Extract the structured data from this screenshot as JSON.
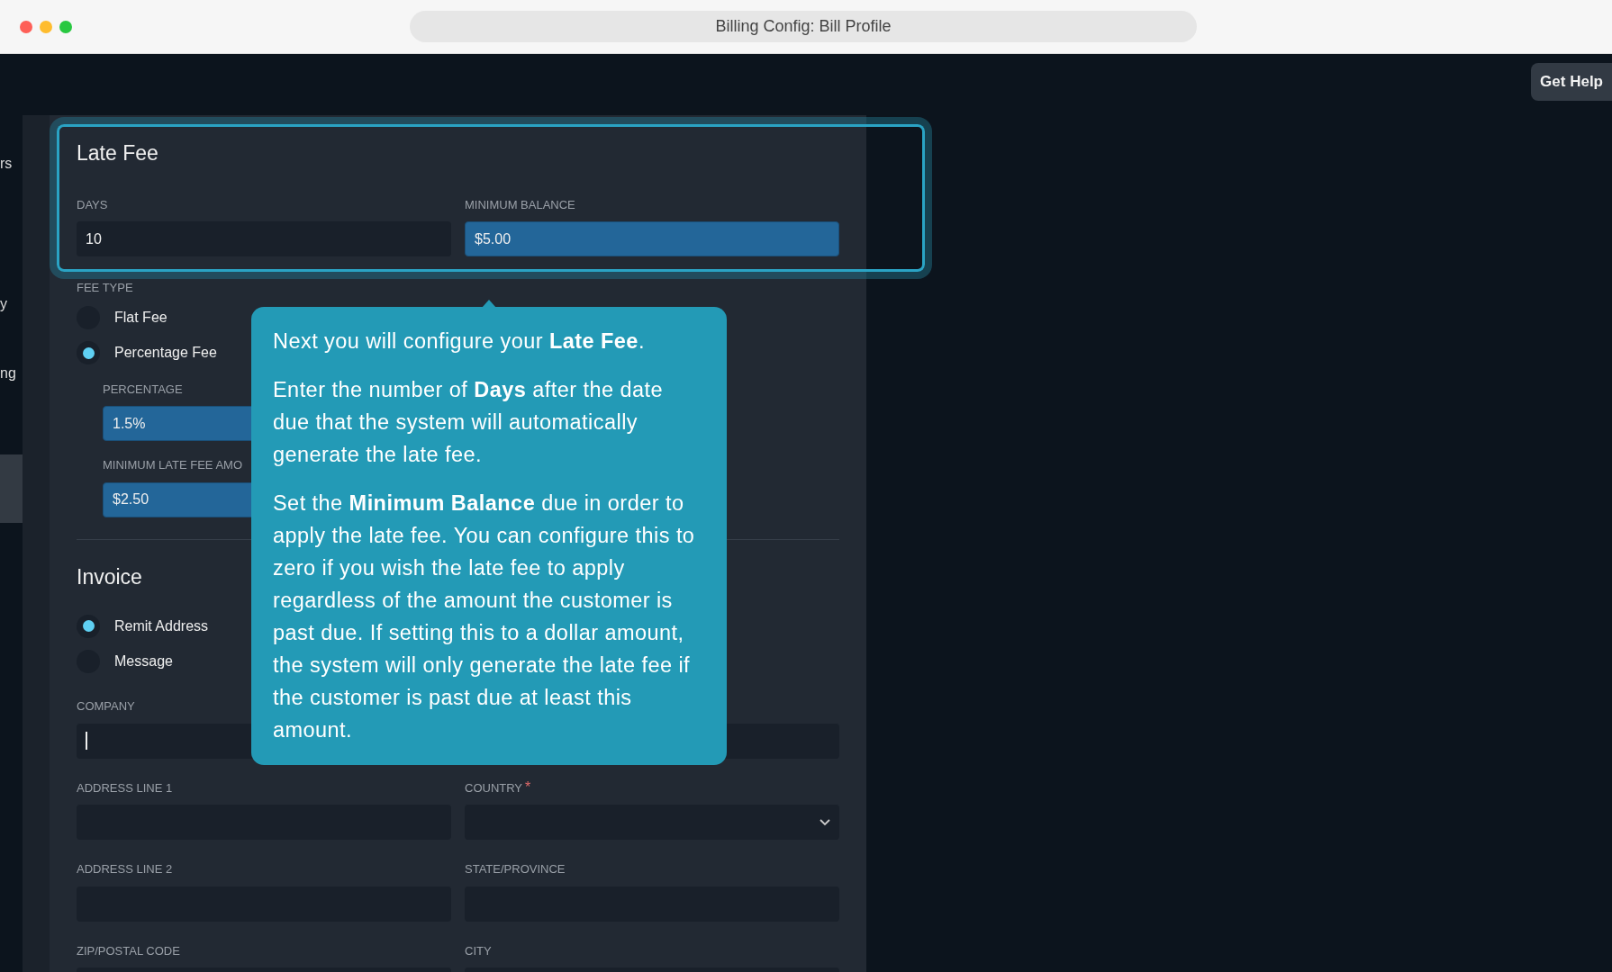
{
  "window": {
    "title": "Billing Config: Bill Profile"
  },
  "header": {
    "help_button": "Get Help"
  },
  "sidebar": {
    "items": [
      {
        "label": "rs",
        "selected": false
      },
      {
        "label": "y",
        "selected": false
      },
      {
        "label": "ng",
        "selected": false
      },
      {
        "selected": true
      }
    ]
  },
  "late_fee": {
    "title": "Late Fee",
    "fields": [
      {
        "label": "DAYS",
        "value": "10",
        "highlighted": false
      },
      {
        "label": "MINIMUM BALANCE",
        "value": "$5.00",
        "highlighted": true
      }
    ],
    "fee_type": {
      "label": "FEE TYPE",
      "options": [
        {
          "label": "Flat Fee",
          "selected": false
        },
        {
          "label": "Percentage Fee",
          "selected": true
        }
      ]
    },
    "percentage_fields": [
      {
        "label": "PERCENTAGE",
        "value": "1.5%",
        "highlighted": true
      },
      {
        "label": "MINIMUM LATE FEE AMO",
        "value": "$2.50",
        "highlighted": true
      }
    ]
  },
  "invoice": {
    "title": "Invoice",
    "options": [
      {
        "label": "Remit Address",
        "selected": true
      },
      {
        "label": "Message",
        "selected": false
      }
    ],
    "rows": [
      [
        {
          "label": "COMPANY",
          "kind": "text",
          "focused": true
        }
      ],
      [
        {
          "label": "ADDRESS LINE 1",
          "kind": "text",
          "focused": false
        },
        {
          "label": "COUNTRY",
          "kind": "select",
          "required_mark": "*"
        }
      ],
      [
        {
          "label": "ADDRESS LINE 2",
          "kind": "text",
          "focused": false
        },
        {
          "label": "STATE/PROVINCE",
          "kind": "text",
          "focused": false
        }
      ],
      [
        {
          "label": "ZIP/POSTAL CODE",
          "kind": "text"
        },
        {
          "label": "CITY",
          "kind": "text"
        }
      ]
    ]
  },
  "tour_tip": {
    "paragraphs": [
      "Next you will configure your **Late Fee**.",
      "Enter the number of **Days** after the date due that the system will automatically generate the late fee.",
      "Set the **Minimum Balance** due in order to apply the late fee. You can configure this to zero if you wish the late fee to apply regardless of the amount the customer is past due. If setting this to a dollar amount, the system will only generate the late fee if the customer is past due at least this amount."
    ]
  }
}
